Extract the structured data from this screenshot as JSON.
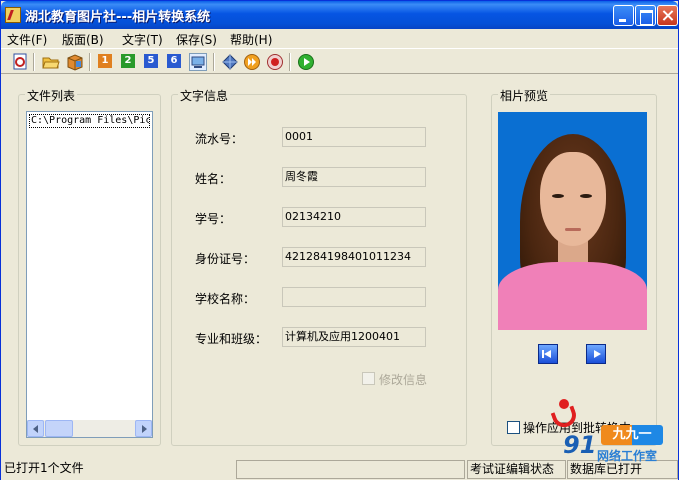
{
  "window": {
    "title": "湖北教育图片社---相片转换系统"
  },
  "menu": {
    "file": "文件(F)",
    "layout": "版面(B)",
    "text": "文字(T)",
    "save": "保存(S)",
    "help": "帮助(H)"
  },
  "toolbar": {
    "icons": [
      "new-doc-icon",
      "open-folder-icon",
      "package-icon",
      "num-1-icon",
      "num-2-icon",
      "num-5-icon",
      "num-6-icon",
      "monitor-icon",
      "diamond-icon",
      "forward-icon",
      "record-icon",
      "play-icon"
    ],
    "num_labels": [
      "1",
      "2",
      "5",
      "6"
    ]
  },
  "file_list": {
    "title": "文件列表",
    "items": [
      "C:\\Program Files\\PicC"
    ]
  },
  "text_info": {
    "title": "文字信息",
    "fields": [
      {
        "label": "流水号：",
        "value": "0001"
      },
      {
        "label": "姓名：",
        "value": "周冬霞"
      },
      {
        "label": "学号：",
        "value": "02134210"
      },
      {
        "label": "身份证号：",
        "value": "421284198401011234"
      },
      {
        "label": "学校名称：",
        "value": ""
      },
      {
        "label": "专业和班级：",
        "value": "计算机及应用1200401"
      }
    ],
    "modify_label": "修改信息"
  },
  "preview": {
    "title": "相片预览",
    "batch_label": "操作应用到批转换中"
  },
  "status": {
    "pane1": "已打开1个文件",
    "pane2": "",
    "pane3": "考试证编辑状态",
    "pane4": "数据库已打开"
  },
  "watermark": {
    "number": "91",
    "logo": "九九一",
    "text": "网络工作室"
  }
}
